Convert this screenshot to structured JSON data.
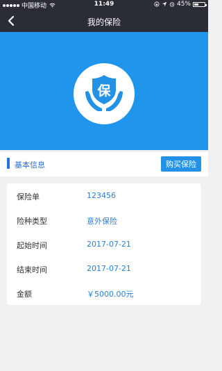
{
  "status_bar": {
    "carrier": "中国移动",
    "time": "11:49",
    "battery_text": "45%",
    "battery_level": 0.45
  },
  "nav": {
    "title": "我的保险",
    "back_icon": "chevron-left-icon"
  },
  "hero": {
    "badge_text": "保",
    "icon": "insurance-shield-hands-icon"
  },
  "section": {
    "label": "基本信息",
    "buy_button_label": "购买保险"
  },
  "details": {
    "rows": [
      {
        "label": "保险单",
        "value": "123456"
      },
      {
        "label": "险种类型",
        "value": "意外保险"
      },
      {
        "label": "起始时间",
        "value": "2017-07-21"
      },
      {
        "label": "结束时间",
        "value": "2017-07-21"
      },
      {
        "label": "金额",
        "value": "￥5000.00元"
      }
    ]
  },
  "colors": {
    "nav_bg": "#2b2d36",
    "hero_bg": "#1f96eb",
    "accent": "#2a6fd9",
    "value_text": "#2a7fd4",
    "page_bg": "#f1f1f3"
  }
}
